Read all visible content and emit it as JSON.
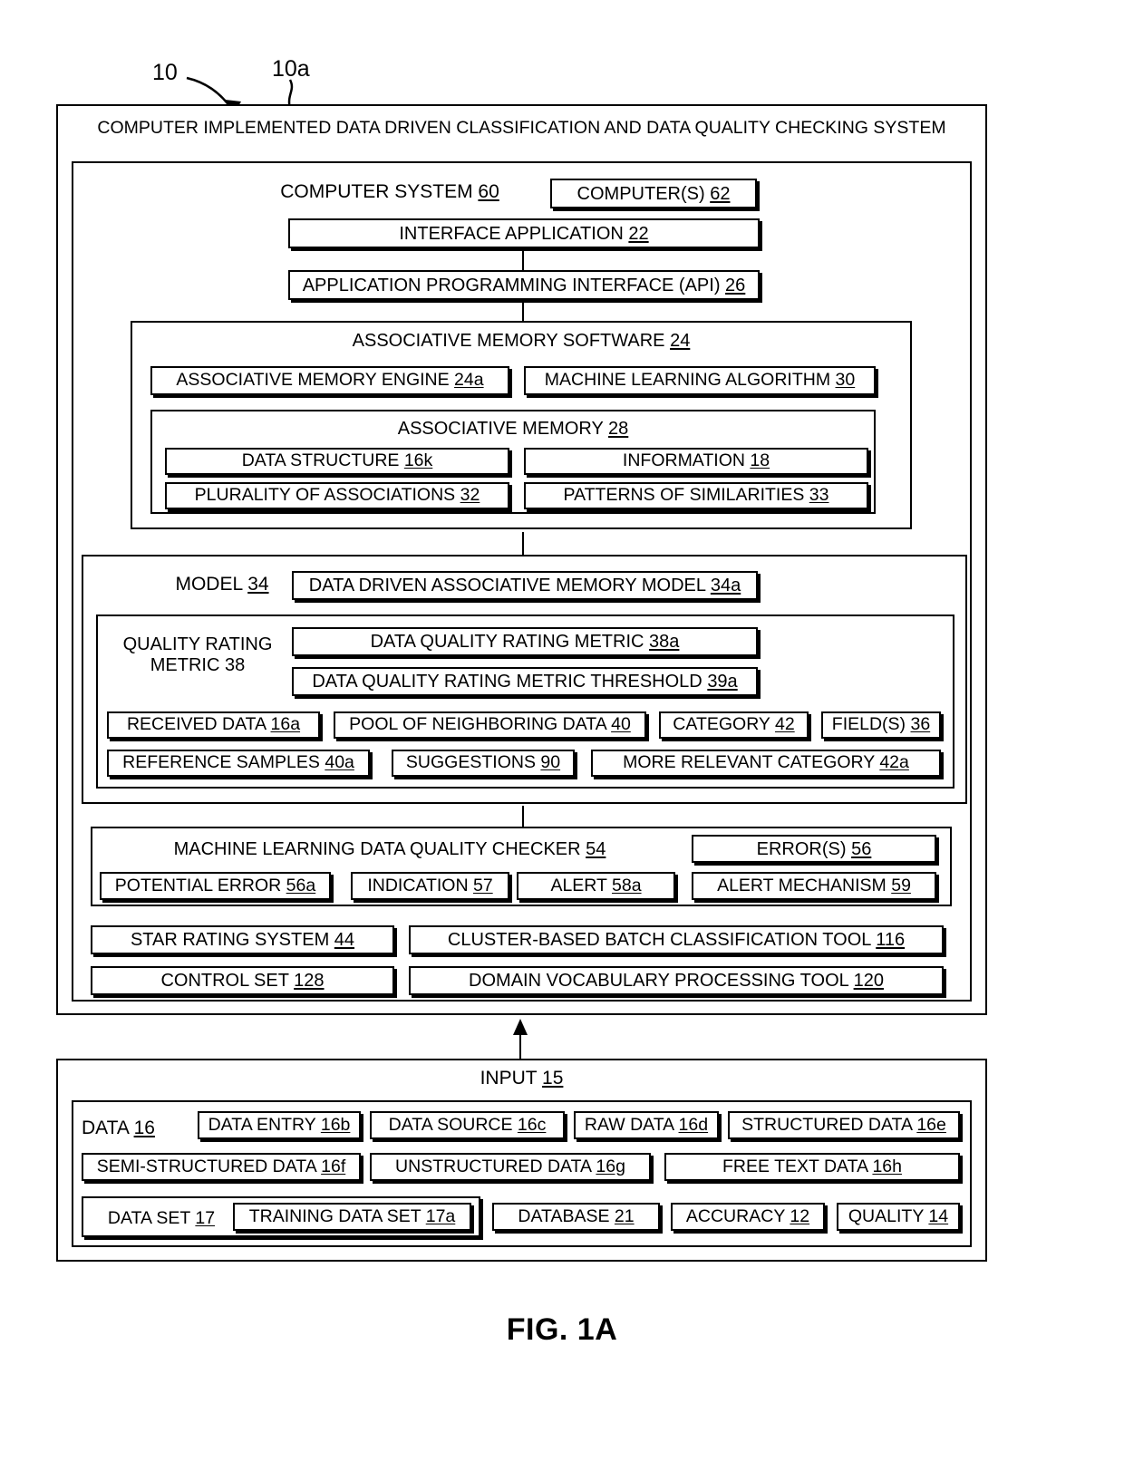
{
  "figure": {
    "caption": "FIG. 1A",
    "lead_numbers": [
      {
        "label": "10"
      },
      {
        "label": "10a"
      }
    ]
  },
  "system": {
    "title": "COMPUTER IMPLEMENTED DATA DRIVEN CLASSIFICATION AND DATA QUALITY CHECKING SYSTEM",
    "computer_system": {
      "label": "COMPUTER SYSTEM",
      "ref": "60"
    },
    "computers": "COMPUTER(S) 62",
    "interface_application": "INTERFACE APPLICATION 22",
    "api": "APPLICATION PROGRAMMING INTERFACE (API) 26",
    "associative_memory_software": {
      "title": "ASSOCIATIVE MEMORY SOFTWARE 24",
      "engine": "ASSOCIATIVE MEMORY ENGINE 24a",
      "ml_algorithm": "MACHINE LEARNING ALGORITHM 30",
      "associative_memory": {
        "title": "ASSOCIATIVE MEMORY 28",
        "items": [
          "DATA STRUCTURE 16k",
          "INFORMATION 18",
          "PLURALITY OF ASSOCIATIONS 32",
          "PATTERNS OF SIMILARITIES 33"
        ]
      }
    },
    "model": {
      "label": "MODEL 34",
      "data_driven_model": "DATA DRIVEN ASSOCIATIVE MEMORY MODEL 34a",
      "quality_rating_metric": {
        "line1": "QUALITY RATING",
        "line2": "METRIC 38",
        "metric": "DATA QUALITY RATING METRIC 38a",
        "threshold": "DATA QUALITY RATING METRIC THRESHOLD 39a"
      },
      "row1": [
        "RECEIVED DATA 16a",
        "POOL OF NEIGHBORING DATA 40",
        "CATEGORY 42",
        "FIELD(S) 36"
      ],
      "row2": [
        "REFERENCE SAMPLES 40a",
        "SUGGESTIONS 90",
        "MORE RELEVANT CATEGORY 42a"
      ]
    },
    "quality_checker": {
      "title": "MACHINE LEARNING DATA QUALITY CHECKER 54",
      "errors": "ERROR(S) 56",
      "row": [
        "POTENTIAL ERROR 56a",
        "INDICATION 57",
        "ALERT 58a",
        "ALERT MECHANISM 59"
      ]
    },
    "tools": {
      "star_rating_system": "STAR RATING SYSTEM 44",
      "cluster_tool": "CLUSTER-BASED BATCH CLASSIFICATION TOOL 116",
      "control_set": "CONTROL SET 128",
      "domain_tool": "DOMAIN VOCABULARY PROCESSING TOOL 120"
    }
  },
  "input": {
    "title": "INPUT  15",
    "data_label": "DATA 16",
    "row1": [
      "DATA ENTRY 16b",
      "DATA SOURCE 16c",
      "RAW DATA 16d",
      "STRUCTURED DATA 16e"
    ],
    "row2": [
      "SEMI-STRUCTURED DATA 16f",
      "UNSTRUCTURED DATA 16g",
      "FREE TEXT DATA 16h"
    ],
    "row3": {
      "data_set": "DATA SET 17",
      "training_data_set": "TRAINING DATA SET 17a",
      "database": "DATABASE 21",
      "accuracy": "ACCURACY 12",
      "quality": "QUALITY 14"
    }
  },
  "colors": {
    "ink": "#000000",
    "paper": "#ffffff"
  }
}
